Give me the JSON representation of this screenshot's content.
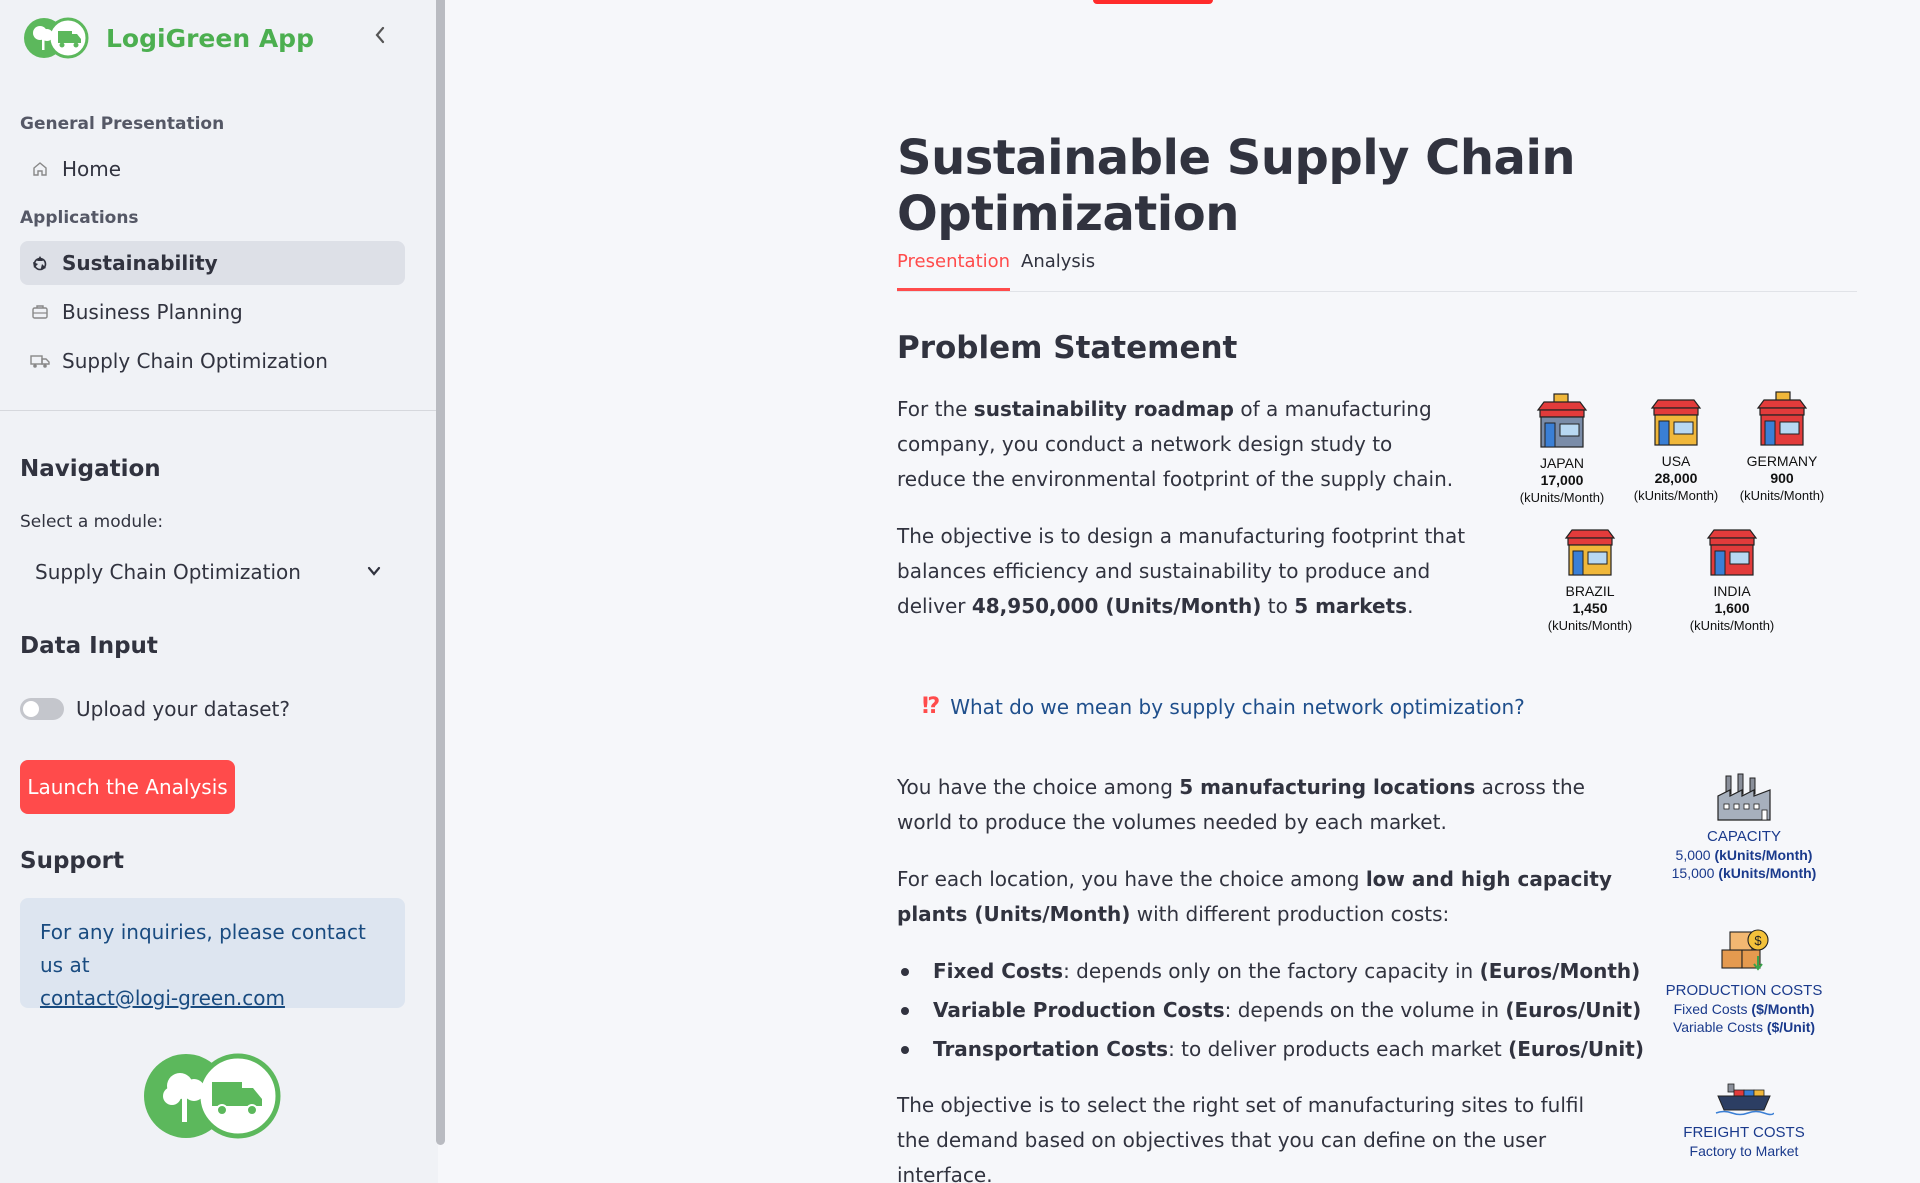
{
  "app": {
    "name": "LogiGreen App"
  },
  "sidebar": {
    "section_general": "General Presentation",
    "home": "Home",
    "section_applications": "Applications",
    "items": [
      {
        "label": "Sustainability",
        "icon": "recycle-icon",
        "active": true
      },
      {
        "label": "Business Planning",
        "icon": "briefcase-icon",
        "active": false
      },
      {
        "label": "Supply Chain Optimization",
        "icon": "truck-icon",
        "active": false
      }
    ],
    "navigation_title": "Navigation",
    "select_label": "Select a module:",
    "select_value": "Supply Chain Optimization",
    "data_input_title": "Data Input",
    "upload_label": "Upload your dataset?",
    "launch_button": "Launch the Analysis",
    "support_title": "Support",
    "support_text": "For any inquiries, please contact us at",
    "support_email": "contact@logi-green.com"
  },
  "main": {
    "title": "Sustainable Supply Chain Optimization",
    "tabs": [
      {
        "label": "Presentation",
        "active": true
      },
      {
        "label": "Analysis",
        "active": false
      }
    ],
    "problem_heading": "Problem Statement",
    "p1": {
      "a": "For the ",
      "b": "sustainability roadmap",
      "c": " of a manufacturing company, you conduct a network design study to reduce the environmental footprint of the supply chain."
    },
    "p2": {
      "a": "The objective is to design a manufacturing footprint that balances efficiency and sustainability to produce and deliver ",
      "b": "48,950,000 (Units/Month)",
      "c": " to ",
      "d": "5 markets",
      "e": "."
    },
    "faq": "What do we mean by supply chain network optimization?",
    "p3": {
      "a": "You have the choice among ",
      "b": "5 manufacturing locations",
      "c": " across the world to produce the volumes needed by each market."
    },
    "p4": {
      "a": "For each location, you have the choice among ",
      "b": "low and high capacity plants (Units/Month)",
      "c": " with different production costs:"
    },
    "bullets": [
      {
        "term": "Fixed Costs",
        "text": ": depends only on the factory capacity in ",
        "unit": "(Euros/Month)"
      },
      {
        "term": "Variable Production Costs",
        "text": ": depends on the volume in ",
        "unit": "(Euros/Unit)"
      },
      {
        "term": "Transportation Costs",
        "text": ": to deliver products each market ",
        "unit": "(Euros/Unit)"
      }
    ],
    "p5": "The objective is to select the right set of manufacturing sites to fulfil the demand based on objectives that you can define on the user interface."
  },
  "markets": [
    {
      "country": "JAPAN",
      "qty": "17,000",
      "unit": "(kUnits/Month)"
    },
    {
      "country": "USA",
      "qty": "28,000",
      "unit": "(kUnits/Month)"
    },
    {
      "country": "GERMANY",
      "qty": "900",
      "unit": "(kUnits/Month)"
    },
    {
      "country": "BRAZIL",
      "qty": "1,450",
      "unit": "(kUnits/Month)"
    },
    {
      "country": "INDIA",
      "qty": "1,600",
      "unit": "(kUnits/Month)"
    }
  ],
  "info_figure": {
    "capacity_title": "CAPACITY",
    "capacity_low": "5,000",
    "capacity_high": "15,000",
    "capacity_unit": "(kUnits/Month)",
    "costs_title": "PRODUCTION COSTS",
    "costs_fixed": "Fixed Costs",
    "costs_fixed_unit": "($/Month)",
    "costs_var": "Variable Costs",
    "costs_var_unit": "($/Unit)",
    "freight_title": "FREIGHT COSTS",
    "freight_sub": "Factory to Market"
  },
  "colors": {
    "accent": "#ff4b4b",
    "brand_green": "#4caf50",
    "link_blue": "#1f4f8c"
  }
}
